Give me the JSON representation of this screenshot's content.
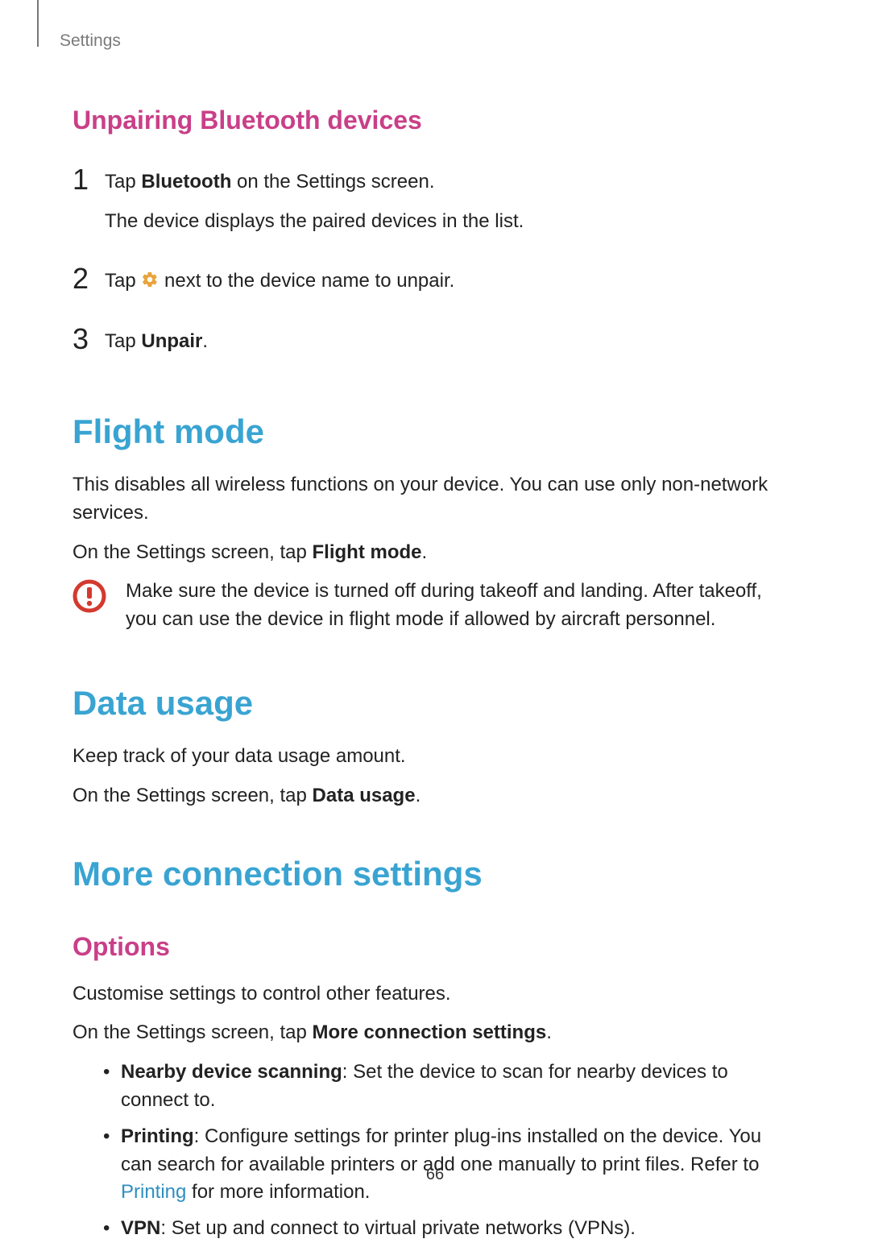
{
  "breadcrumb": "Settings",
  "page_number": "66",
  "unpair": {
    "heading": "Unpairing Bluetooth devices",
    "steps": [
      {
        "num": "1",
        "line1_pre": "Tap ",
        "line1_bold": "Bluetooth",
        "line1_post": " on the Settings screen.",
        "line2": "The device displays the paired devices in the list."
      },
      {
        "num": "2",
        "line1_pre": "Tap ",
        "line1_post": " next to the device name to unpair."
      },
      {
        "num": "3",
        "line1_pre": "Tap ",
        "line1_bold": "Unpair",
        "line1_post": "."
      }
    ]
  },
  "flight": {
    "heading": "Flight mode",
    "p1": "This disables all wireless functions on your device. You can use only non-network services.",
    "p2_pre": "On the Settings screen, tap ",
    "p2_bold": "Flight mode",
    "p2_post": ".",
    "warning": "Make sure the device is turned off during takeoff and landing. After takeoff, you can use the device in flight mode if allowed by aircraft personnel."
  },
  "data": {
    "heading": "Data usage",
    "p1": "Keep track of your data usage amount.",
    "p2_pre": "On the Settings screen, tap ",
    "p2_bold": "Data usage",
    "p2_post": "."
  },
  "more": {
    "heading": "More connection settings",
    "options_heading": "Options",
    "p1": "Customise settings to control other features.",
    "p2_pre": "On the Settings screen, tap ",
    "p2_bold": "More connection settings",
    "p2_post": ".",
    "bullets": [
      {
        "bold": "Nearby device scanning",
        "rest": ": Set the device to scan for nearby devices to connect to."
      },
      {
        "bold": "Printing",
        "rest_pre": ": Configure settings for printer plug-ins installed on the device. You can search for available printers or add one manually to print files. Refer to ",
        "link": "Printing",
        "rest_post": " for more information."
      },
      {
        "bold": "VPN",
        "rest": ": Set up and connect to virtual private networks (VPNs)."
      }
    ]
  }
}
